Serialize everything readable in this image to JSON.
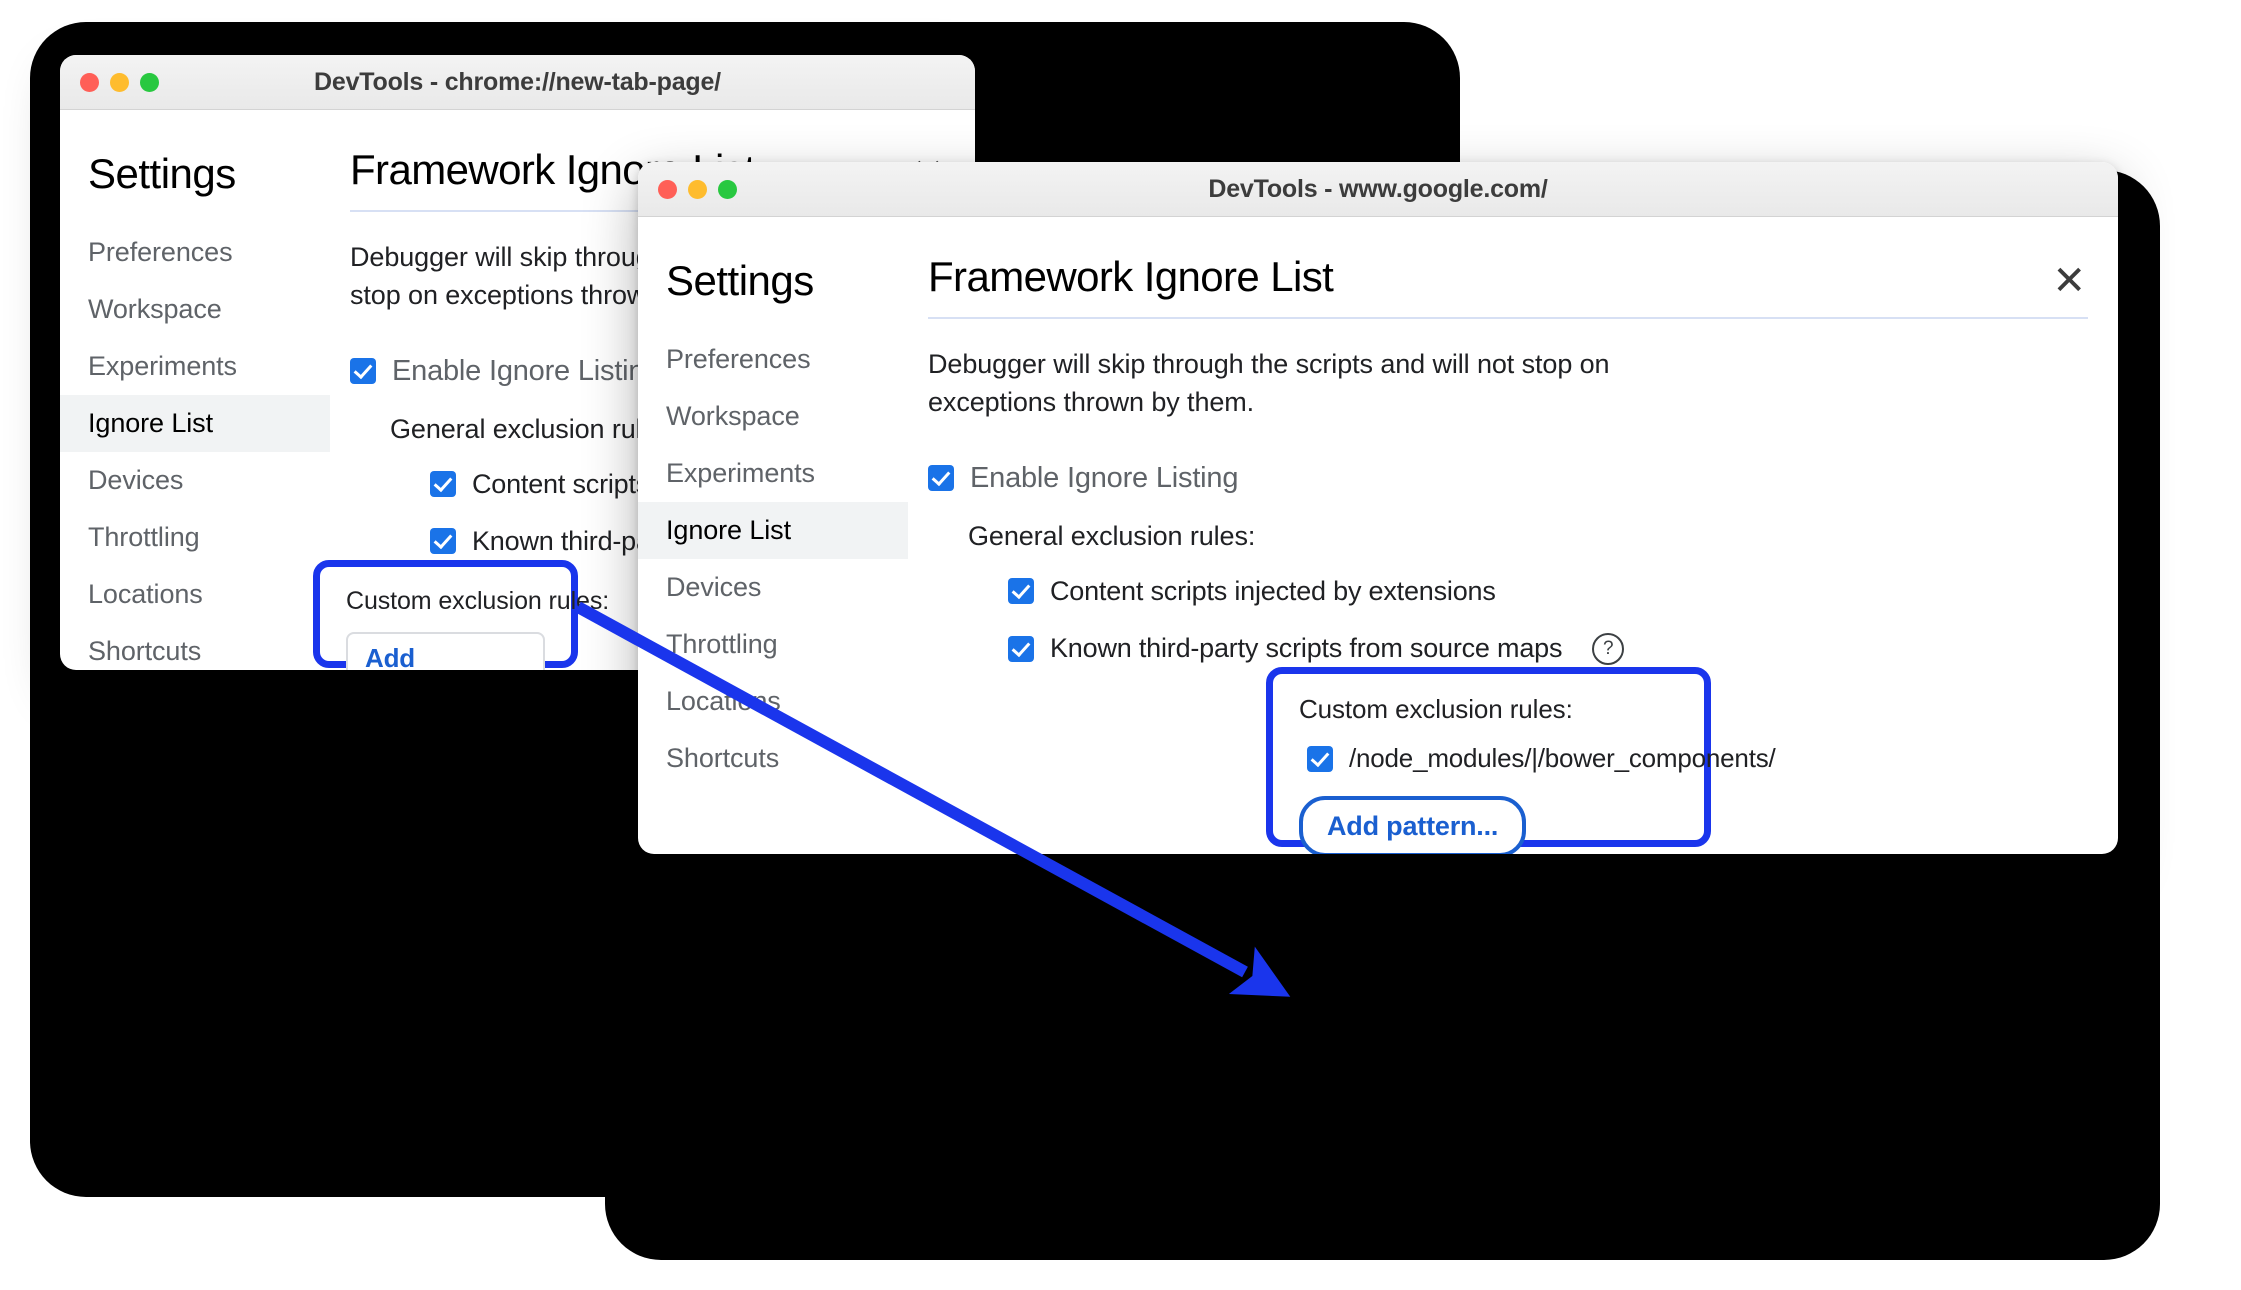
{
  "theme": {
    "accent_blue": "#1a73e8",
    "highlight_blue": "#1a35ec",
    "link_blue": "#1a5fd0",
    "sidebar_active_bg": "#f1f3f4",
    "backdrop": "#000000"
  },
  "windows": [
    {
      "id": "new-tab-page",
      "title": "DevTools - chrome://new-tab-page/",
      "traffic_lights": [
        "close-red",
        "minimize-yellow",
        "zoom-green"
      ],
      "close_icon": "✕",
      "sidebar": {
        "heading": "Settings",
        "items": [
          {
            "label": "Preferences",
            "active": false
          },
          {
            "label": "Workspace",
            "active": false
          },
          {
            "label": "Experiments",
            "active": false
          },
          {
            "label": "Ignore List",
            "active": true
          },
          {
            "label": "Devices",
            "active": false
          },
          {
            "label": "Throttling",
            "active": false
          },
          {
            "label": "Locations",
            "active": false
          },
          {
            "label": "Shortcuts",
            "active": false
          }
        ]
      },
      "content": {
        "title": "Framework Ignore List",
        "description": "Debugger will skip through the scripts and will not stop on exceptions thrown by them.",
        "enable_checkbox": {
          "label": "Enable Ignore Listing",
          "checked": true
        },
        "general_label": "General exclusion rules:",
        "general_rules": [
          {
            "label": "Content scripts injected by extensions",
            "checked": true,
            "help": false
          },
          {
            "label": "Known third-party scripts from source maps",
            "checked": true,
            "help": true
          }
        ],
        "custom_label": "Custom exclusion rules:",
        "custom_rules": [],
        "add_pattern_label": "Add pattern...",
        "add_pattern_focused": false
      }
    },
    {
      "id": "google",
      "title": "DevTools - www.google.com/",
      "traffic_lights": [
        "close-red",
        "minimize-yellow",
        "zoom-green"
      ],
      "close_icon": "✕",
      "sidebar": {
        "heading": "Settings",
        "items": [
          {
            "label": "Preferences",
            "active": false
          },
          {
            "label": "Workspace",
            "active": false
          },
          {
            "label": "Experiments",
            "active": false
          },
          {
            "label": "Ignore List",
            "active": true
          },
          {
            "label": "Devices",
            "active": false
          },
          {
            "label": "Throttling",
            "active": false
          },
          {
            "label": "Locations",
            "active": false
          },
          {
            "label": "Shortcuts",
            "active": false
          }
        ]
      },
      "content": {
        "title": "Framework Ignore List",
        "description": "Debugger will skip through the scripts and will not stop on exceptions thrown by them.",
        "enable_checkbox": {
          "label": "Enable Ignore Listing",
          "checked": true
        },
        "general_label": "General exclusion rules:",
        "general_rules": [
          {
            "label": "Content scripts injected by extensions",
            "checked": true,
            "help": false
          },
          {
            "label": "Known third-party scripts from source maps",
            "checked": true,
            "help": true
          }
        ],
        "custom_label": "Custom exclusion rules:",
        "custom_rules": [
          {
            "label": "/node_modules/|/bower_components/",
            "checked": true
          }
        ],
        "add_pattern_label": "Add pattern...",
        "add_pattern_focused": true
      }
    }
  ],
  "annotation": {
    "arrow_color": "#1a35ec",
    "description": "Arrow from Add pattern box in first window to custom rules box in second window"
  },
  "help_glyph": "?"
}
